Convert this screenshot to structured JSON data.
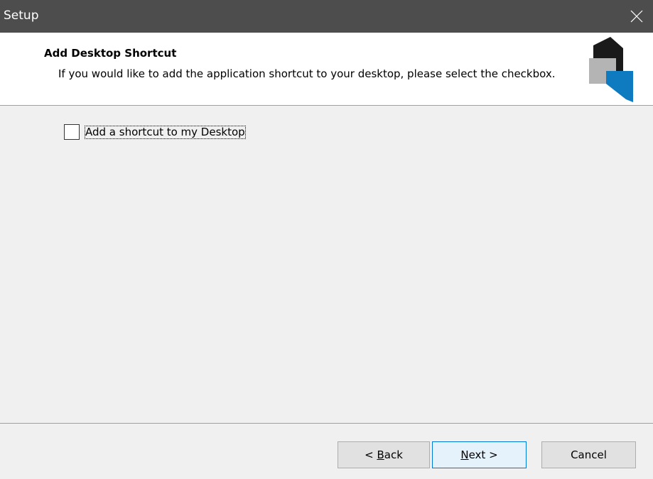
{
  "window": {
    "title": "Setup",
    "close_icon": "close-icon"
  },
  "header": {
    "title": "Add Desktop Shortcut",
    "description": "If you would like to add the application shortcut to your desktop, please select the checkbox.",
    "logo_icon": "setup-logo-icon"
  },
  "options": {
    "desktop_shortcut": {
      "label": "Add a shortcut to my Desktop",
      "checked": false
    }
  },
  "buttons": {
    "back_label": "< Back",
    "back_access_key": "B",
    "next_label": "Next >",
    "next_access_key": "N",
    "cancel_label": "Cancel"
  },
  "colors": {
    "titlebar": "#4d4d4d",
    "logo_dark": "#1a1a1a",
    "logo_gray": "#b4b4b4",
    "logo_blue": "#0e7bc0"
  }
}
